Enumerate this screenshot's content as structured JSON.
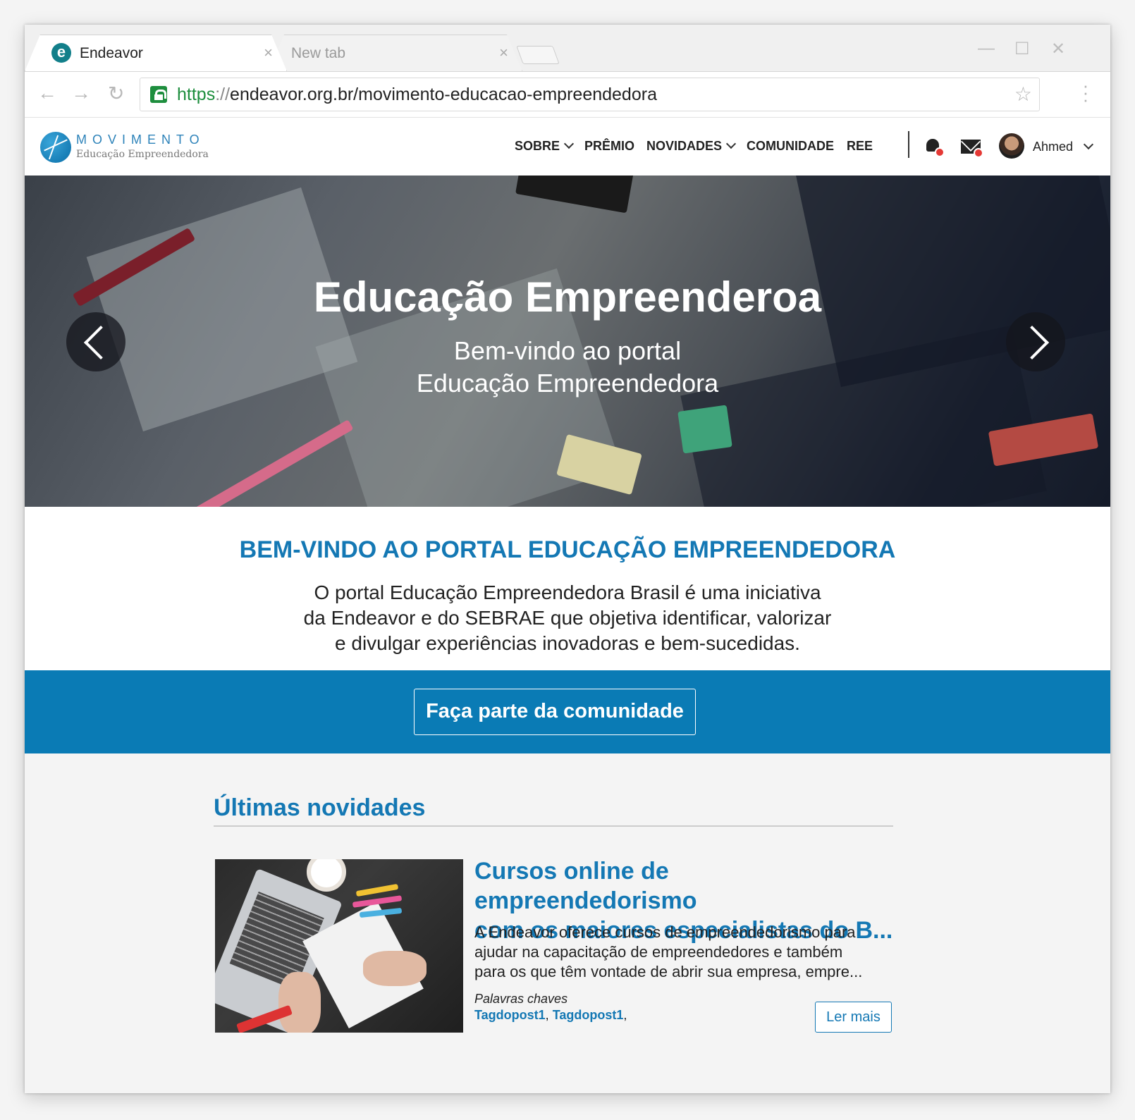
{
  "browser": {
    "tabs": [
      {
        "title": "Endeavor",
        "favicon_letter": "e",
        "close": "×"
      },
      {
        "title": "New tab",
        "close": "×"
      }
    ],
    "controls": {
      "minimize": "—",
      "maximize": "☐",
      "close": "✕"
    },
    "nav": {
      "back": "←",
      "forward": "→",
      "reload": "↻"
    },
    "url": {
      "scheme": "https",
      "separator": "://",
      "rest": "endeavor.org.br/movimento-educacao-empreendedora"
    },
    "bookmark_icon": "star-icon",
    "menu_icon": "kebab-icon",
    "secure_icon": "lock-icon"
  },
  "site": {
    "logo": {
      "title": "MOVIMENTO",
      "subtitle": "Educação Empreendedora"
    },
    "nav": [
      {
        "label": "SOBRE",
        "dropdown": true
      },
      {
        "label": "PRÊMIO",
        "dropdown": false
      },
      {
        "label": "NOVIDADES",
        "dropdown": true
      },
      {
        "label": "COMUNIDADE",
        "dropdown": false
      },
      {
        "label": "REE",
        "dropdown": false
      }
    ],
    "user": {
      "name": "Ahmed"
    },
    "colors": {
      "brand_blue": "#1478b4",
      "cta_blue": "#0a7bb5",
      "notification_red": "#e53935"
    }
  },
  "hero": {
    "title": "Educação Empreenderoa",
    "subtitle_line1": "Bem-vindo ao portal",
    "subtitle_line2": "Educação Empreendedora"
  },
  "welcome": {
    "title": "BEM-VINDO AO PORTAL EDUCAÇÃO EMPREENDEDORA",
    "text_line1": "O portal Educação Empreendedora Brasil é uma iniciativa",
    "text_line2": "da Endeavor e do SEBRAE que objetiva identificar, valorizar",
    "text_line3": "e divulgar experiências inovadoras e bem-sucedidas."
  },
  "cta": {
    "label": "Faça parte da comunidade"
  },
  "news": {
    "section_title": "Últimas novidades",
    "items": [
      {
        "headline_line1": "Cursos online de empreendedorismo",
        "headline_line2": "com os maiores especialistas do B...",
        "excerpt_line1": "A Endeavor oferece cursos de empreendedorismo para",
        "excerpt_line2": "ajudar na capacitação de empreendedores e também",
        "excerpt_line3": "para os que têm vontade de abrir sua empresa, empre...",
        "keywords_label": "Palavras chaves",
        "tags": [
          "Tagdopost1",
          "Tagdopost1"
        ],
        "read_more": "Ler mais"
      }
    ]
  }
}
